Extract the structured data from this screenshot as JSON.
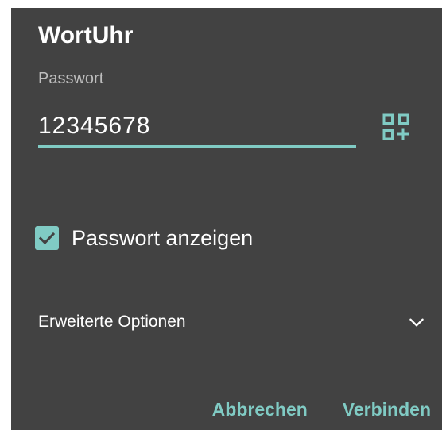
{
  "dialog": {
    "title": "WortUhr",
    "password_label": "Passwort",
    "password_value": "12345678",
    "qr_icon": "qr-code-add-icon",
    "show_password": {
      "checked": true,
      "label": "Passwort anzeigen",
      "icon": "checkmark-icon"
    },
    "advanced": {
      "label": "Erweiterte Optionen",
      "icon": "chevron-down-icon"
    },
    "actions": {
      "cancel_label": "Abbrechen",
      "connect_label": "Verbinden"
    }
  },
  "colors": {
    "background": "#424242",
    "accent": "#80cbc4",
    "text": "#ffffff",
    "label": "#bdbdbd"
  }
}
